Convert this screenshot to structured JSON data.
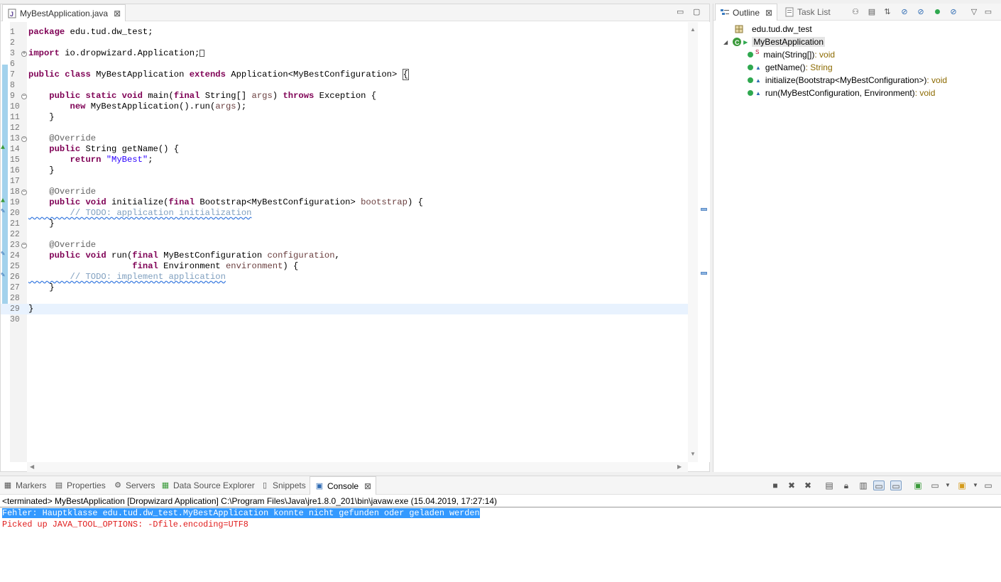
{
  "editor": {
    "tab_label": "MyBestApplication.java",
    "tab_close": "⊠",
    "minimize": "▭",
    "maximize": "▢",
    "lines": [
      {
        "n": "1",
        "html": "<span class='kw'>package</span> edu.tud.dw_test;"
      },
      {
        "n": "2",
        "html": ""
      },
      {
        "n": "3",
        "html": "<span class='kw'>import</span> io.dropwizard.Application;<span style='border:1px solid #555;display:inline-block;width:7px;height:10px;vertical-align:middle'></span>"
      },
      {
        "n": "6",
        "html": ""
      },
      {
        "n": "7",
        "html": "<span class='kw'>public class</span> MyBestApplication <span class='kw'>extends</span> Application&lt;MyBestConfiguration&gt; <span style='border:1px solid #555'>{</span>"
      },
      {
        "n": "8",
        "html": ""
      },
      {
        "n": "9",
        "html": "    <span class='kw'>public static void</span> main(<span class='kw'>final</span> String[] <span class='var'>args</span>) <span class='kw'>throws</span> Exception {"
      },
      {
        "n": "10",
        "html": "        <span class='kw'>new</span> MyBestApplication().run(<span class='var'>args</span>);"
      },
      {
        "n": "11",
        "html": "    }"
      },
      {
        "n": "12",
        "html": ""
      },
      {
        "n": "13",
        "html": "    <span class='ann'>@Override</span>"
      },
      {
        "n": "14",
        "html": "    <span class='kw'>public</span> String getName() {"
      },
      {
        "n": "15",
        "html": "        <span class='kw'>return</span> <span class='str'>\"MyBest\"</span>;"
      },
      {
        "n": "16",
        "html": "    }"
      },
      {
        "n": "17",
        "html": ""
      },
      {
        "n": "18",
        "html": "    <span class='ann'>@Override</span>"
      },
      {
        "n": "19",
        "html": "    <span class='kw'>public void</span> initialize(<span class='kw'>final</span> Bootstrap&lt;MyBestConfiguration&gt; <span class='var'>bootstrap</span>) {"
      },
      {
        "n": "20",
        "html": "<span class='cmt todo'>        // TODO: application initialization</span>"
      },
      {
        "n": "21",
        "html": "    }"
      },
      {
        "n": "22",
        "html": ""
      },
      {
        "n": "23",
        "html": "    <span class='ann'>@Override</span>"
      },
      {
        "n": "24",
        "html": "    <span class='kw'>public void</span> run(<span class='kw'>final</span> MyBestConfiguration <span class='var'>configuration</span>,"
      },
      {
        "n": "25",
        "html": "                    <span class='kw'>final</span> Environment <span class='var'>environment</span>) {"
      },
      {
        "n": "26",
        "html": "<span class='cmt todo'>        // TODO: implement application</span>"
      },
      {
        "n": "27",
        "html": "    }"
      },
      {
        "n": "28",
        "html": ""
      },
      {
        "n": "29",
        "html": "}"
      },
      {
        "n": "30",
        "html": ""
      }
    ]
  },
  "outline": {
    "tab_outline": "Outline",
    "tab_close": "⊠",
    "tab_tasklist": "Task List",
    "package": "edu.tud.dw_test",
    "class_name": "MyBestApplication",
    "methods": [
      {
        "name": "main(String[])",
        "ret": " : void",
        "static": "S"
      },
      {
        "name": "getName()",
        "ret": " : String",
        "static": ""
      },
      {
        "name": "initialize(Bootstrap<MyBestConfiguration>)",
        "ret": " : void",
        "static": ""
      },
      {
        "name": "run(MyBestConfiguration, Environment)",
        "ret": " : void",
        "static": ""
      }
    ]
  },
  "console": {
    "tabs": [
      "Markers",
      "Properties",
      "Servers",
      "Data Source Explorer",
      "Snippets",
      "Console"
    ],
    "header": "<terminated> MyBestApplication [Dropwizard Application] C:\\Program Files\\Java\\jre1.8.0_201\\bin\\javaw.exe (15.04.2019, 17:27:14)",
    "line1": "Fehler: Hauptklasse edu.tud.dw_test.MyBestApplication konnte nicht gefunden oder geladen werden",
    "line2": "Picked up JAVA_TOOL_OPTIONS: -Dfile.encoding=UTF8"
  },
  "colors": {
    "keyword": "#7f0055",
    "string": "#2a00ff",
    "error_text": "#e01b1b",
    "selection": "#3399ff"
  }
}
